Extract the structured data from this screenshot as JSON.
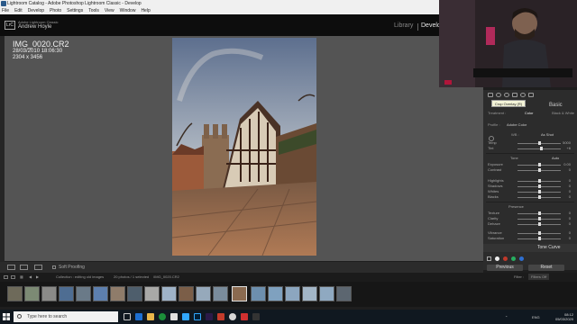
{
  "window": {
    "title": "Lightroom Catalog - Adobe Photoshop Lightroom Classic - Develop"
  },
  "menu": [
    "File",
    "Edit",
    "Develop",
    "Photo",
    "Settings",
    "Tools",
    "View",
    "Window",
    "Help"
  ],
  "identity": {
    "app_line": "Adobe Lightroom Classic",
    "user": "Andrew Hoyle",
    "badge": "LrC"
  },
  "modules": {
    "library": "Library",
    "develop": "Develop"
  },
  "photo_info": {
    "filename": "IMG_0020.CR2",
    "datetime": "28/03/2010 18:06:30",
    "dimensions": "2304 x 3456"
  },
  "tooltip": "Crop Overlay (R)",
  "basic_panel": {
    "title": "Basic",
    "treatment_label": "Treatment :",
    "treatment_options": [
      "Color",
      "Black & White"
    ],
    "profile_label": "Profile :",
    "profile_value": "Adobe Color",
    "wb_label": "WB :",
    "wb_value": "As Shot",
    "temp_label": "Temp",
    "temp_value": "5000",
    "tint_label": "Tint",
    "tint_value": "+6",
    "tone_label": "Tone",
    "tone_auto": "Auto",
    "exposure_label": "Exposure",
    "exposure_value": "0.00",
    "contrast_label": "Contrast",
    "contrast_value": "0",
    "highlights_label": "Highlights",
    "highlights_value": "0",
    "shadows_label": "Shadows",
    "shadows_value": "0",
    "whites_label": "Whites",
    "whites_value": "0",
    "blacks_label": "Blacks",
    "blacks_value": "0",
    "presence_label": "Presence",
    "texture_label": "Texture",
    "texture_value": "0",
    "clarity_label": "Clarity",
    "clarity_value": "0",
    "dehaze_label": "Dehaze",
    "dehaze_value": "0",
    "vibrance_label": "Vibrance",
    "vibrance_value": "0",
    "saturation_label": "Saturation",
    "saturation_value": "0"
  },
  "tone_curve": {
    "title": "Tone Curve"
  },
  "panel_buttons": {
    "previous": "Previous",
    "reset": "Reset"
  },
  "toolbar": {
    "soft_proofing": "Soft Proofing"
  },
  "filmstrip_bar": {
    "collection": "Collection : editing old images",
    "count": "20 photos / 1 selected",
    "selected_file": "/IMG_0020.CR2",
    "filter_label": "Filter :",
    "filter_value": "Filters Off"
  },
  "taskbar": {
    "search_placeholder": "Type here to search",
    "time": "08:12",
    "date": "05/03/2020",
    "lang": "ENG"
  },
  "colors": {
    "photo_sky": "#7e8fa6",
    "panel_bg": "#2c2c2c",
    "taskbar": "#101820",
    "titlebar": "#f0f0f0"
  }
}
